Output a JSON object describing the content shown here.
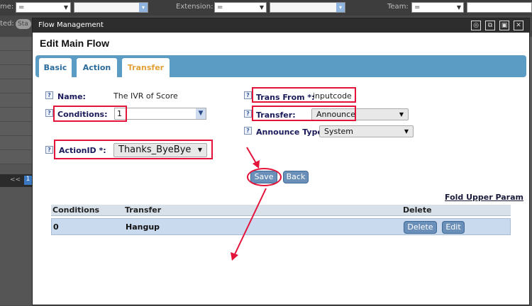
{
  "background": {
    "name_label": "me:",
    "name_op": "=",
    "extension_label": "Extension:",
    "extension_op": "=",
    "team_label": "Team:",
    "team_op": "=",
    "status_label": "ted:",
    "status_badge": "Sta",
    "pager_prev": "<<",
    "pager_page": "1"
  },
  "modal": {
    "window_title": "Flow Management",
    "heading": "Edit Main Flow",
    "tabs": [
      {
        "label": "Basic",
        "active": false
      },
      {
        "label": "Action",
        "active": false
      },
      {
        "label": "Transfer",
        "active": true
      }
    ],
    "form": {
      "name_label": "Name:",
      "name_value": "The IVR of Score",
      "conditions_label": "Conditions:",
      "conditions_value": "1",
      "action_id_label": "ActionID *:",
      "action_id_value": "Thanks_ByeBye",
      "trans_from_label": "Trans From *:",
      "trans_from_value": "inputcode",
      "transfer_label": "Transfer:",
      "transfer_value": "Announce",
      "announce_type_label": "Announce Type:",
      "announce_type_value": "System",
      "help_glyph": "?"
    },
    "buttons": {
      "save": "Save",
      "back": "Back"
    },
    "fold_link": "Fold Upper Param",
    "table": {
      "headers": [
        "Conditions",
        "Transfer",
        "Delete"
      ],
      "rows": [
        {
          "conditions": "0",
          "transfer": "Hangup",
          "delete_btn": "Delete",
          "edit_btn": "Edit"
        }
      ]
    }
  },
  "colors": {
    "annotation_red": "#e4133a",
    "tab_bar": "#5a9cc4",
    "active_tab_text": "#e3a036"
  }
}
